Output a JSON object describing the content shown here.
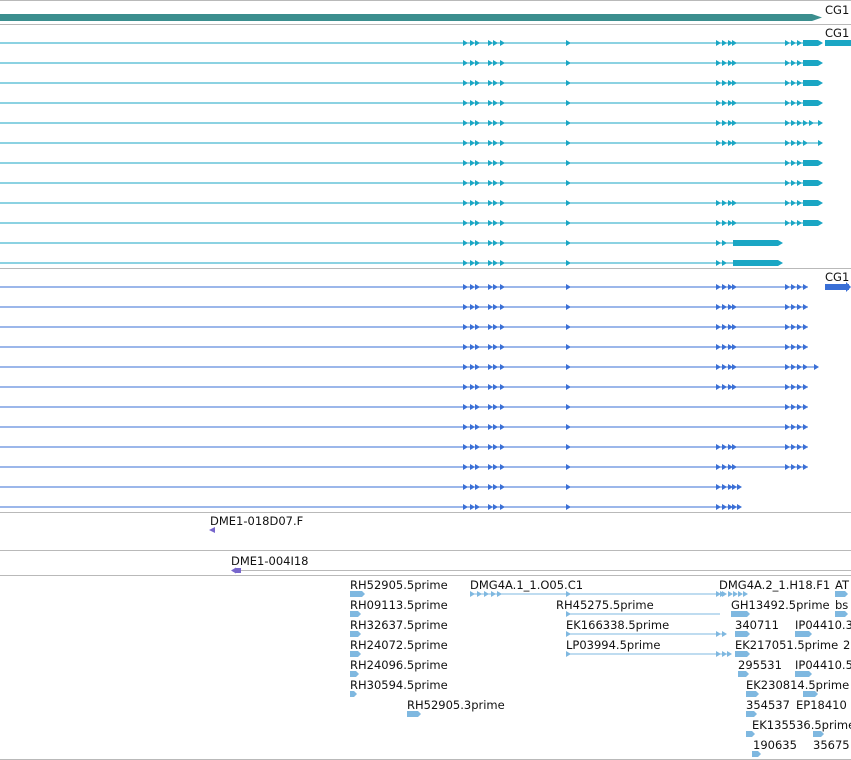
{
  "colors": {
    "gene_teal": "#3b8e8e",
    "transcript_cyan": "#1aa6c4",
    "transcript_blue": "#3a6fd6",
    "clone_purple": "#7766cc",
    "est_lightblue": "#7fb8e0",
    "separator": "#b9b9b9"
  },
  "gene_track": {
    "label": "CG1"
  },
  "transcript_group_1": {
    "label": "CG1",
    "row_count": 12
  },
  "transcript_group_2": {
    "label": "CG1",
    "row_count": 12
  },
  "clones": [
    {
      "label": "DME1-018D07.F",
      "strand": "minus"
    },
    {
      "label": "DME1-004I18",
      "strand": "minus"
    }
  ],
  "ests": [
    {
      "id": "e1",
      "label": "RH52905.5prime"
    },
    {
      "id": "e2",
      "label": "RH09113.5prime"
    },
    {
      "id": "e3",
      "label": "RH32637.5prime"
    },
    {
      "id": "e4",
      "label": "RH24072.5prime"
    },
    {
      "id": "e5",
      "label": "RH24096.5prime"
    },
    {
      "id": "e6",
      "label": "RH30594.5prime"
    },
    {
      "id": "e7",
      "label": "RH52905.3prime"
    },
    {
      "id": "e8",
      "label": "DMG4A.1_1.O05.C1"
    },
    {
      "id": "e9",
      "label": "RH45275.5prime"
    },
    {
      "id": "e10",
      "label": "EK166338.5prime"
    },
    {
      "id": "e11",
      "label": "LP03994.5prime"
    },
    {
      "id": "e12",
      "label": "DMG4A.2_1.H18.F1"
    },
    {
      "id": "e13",
      "label": "AT"
    },
    {
      "id": "e14",
      "label": "GH13492.5prime"
    },
    {
      "id": "e15",
      "label": "bs"
    },
    {
      "id": "e16",
      "label": "340711"
    },
    {
      "id": "e17",
      "label": "IP04410.3"
    },
    {
      "id": "e18",
      "label": "EK217051.5prime"
    },
    {
      "id": "e19",
      "label": "2"
    },
    {
      "id": "e20",
      "label": "295531"
    },
    {
      "id": "e21",
      "label": "IP04410.5"
    },
    {
      "id": "e22",
      "label": "EK230814.5prime"
    },
    {
      "id": "e23",
      "label": "354537"
    },
    {
      "id": "e24",
      "label": "EP18410"
    },
    {
      "id": "e25",
      "label": "EK135536.5prime"
    },
    {
      "id": "e26",
      "label": "190635"
    },
    {
      "id": "e27",
      "label": "35675"
    }
  ]
}
